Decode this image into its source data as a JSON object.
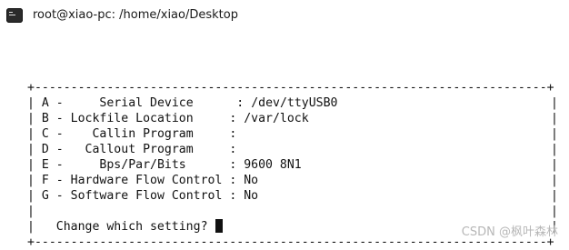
{
  "window": {
    "title": "root@xiao-pc: /home/xiao/Desktop",
    "icon": "terminal-icon"
  },
  "terminal": {
    "border_top": "+-----------------------------------------------------------------------+",
    "border_bottom": "+-----------------------------------------------------------------------+",
    "menu": [
      {
        "key": "A",
        "label": "    Serial Device      ",
        "value": "/dev/ttyUSB0"
      },
      {
        "key": "B",
        "label": "Lockfile Location     ",
        "value": "/var/lock"
      },
      {
        "key": "C",
        "label": "   Callin Program     ",
        "value": ""
      },
      {
        "key": "D",
        "label": "  Callout Program     ",
        "value": ""
      },
      {
        "key": "E",
        "label": "    Bps/Par/Bits      ",
        "value": "9600 8N1"
      },
      {
        "key": "F",
        "label": "Hardware Flow Control ",
        "value": "No"
      },
      {
        "key": "G",
        "label": "Software Flow Control ",
        "value": "No"
      }
    ],
    "prompt": "   Change which setting? "
  },
  "watermark": "CSDN @枫叶森林"
}
